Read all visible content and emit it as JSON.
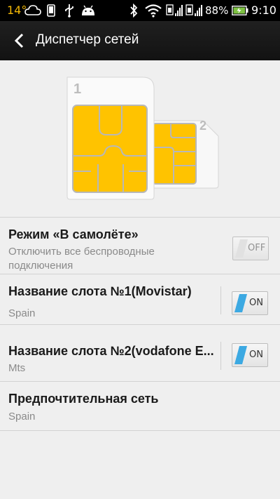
{
  "status_bar": {
    "temperature": "14°",
    "battery_percent": "88%",
    "time": "9:10"
  },
  "action_bar": {
    "title": "Диспетчер сетей"
  },
  "sim_labels": {
    "sim1": "1",
    "sim2": "2"
  },
  "settings": [
    {
      "title": "Режим «В самолёте»",
      "subtitle": "Отключить все беспроводные подключения",
      "toggle": "OFF"
    },
    {
      "title": "Название слота №1(Movistar)",
      "subtitle": "Spain",
      "toggle": "ON"
    },
    {
      "title": "Название слота №2(vodafone E...",
      "subtitle": "Mts",
      "toggle": "ON"
    },
    {
      "title": "Предпочтительная сеть",
      "subtitle": "Spain"
    }
  ],
  "colors": {
    "toggle_on": "#3ca9e2",
    "sim_chip": "#ffc300",
    "accent_temp": "#f2b705"
  }
}
